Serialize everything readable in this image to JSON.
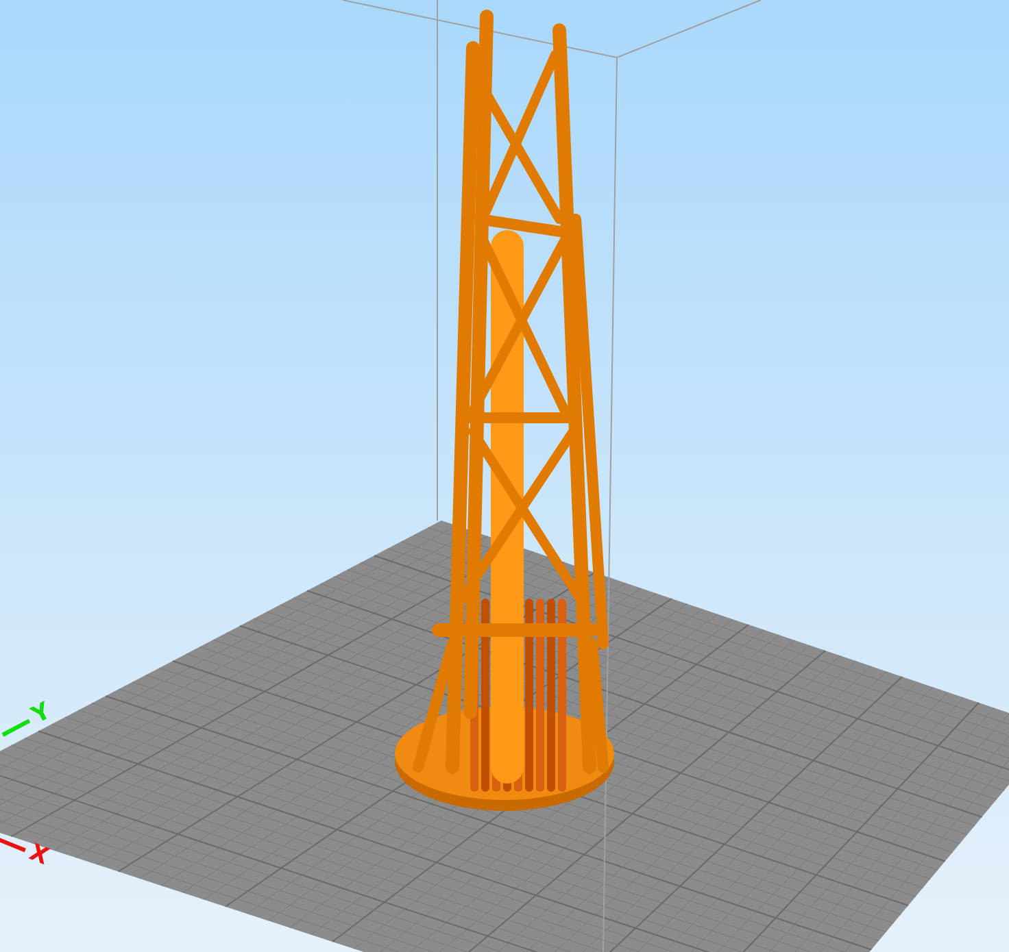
{
  "viewport": {
    "axes": [
      {
        "label": "Y",
        "color": "#11dd11"
      },
      {
        "label": "X",
        "color": "#ee1111"
      }
    ]
  }
}
